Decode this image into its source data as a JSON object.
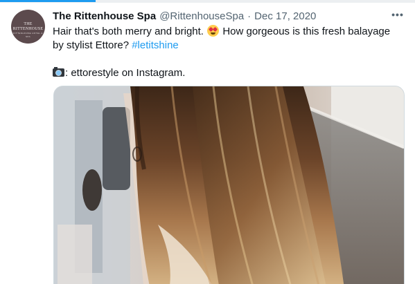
{
  "tweet": {
    "display_name": "The Rittenhouse Spa",
    "handle": "@RittenhouseSpa",
    "separator": "·",
    "date": "Dec 17, 2020",
    "more_label": "•••",
    "text_line1_part1": "Hair that's both merry and bright.",
    "text_line1_part2": "How gorgeous is this fresh balayage",
    "text_line2_part1": "by stylist Ettore?",
    "hashtag": "#letitshine",
    "credit": ": ettorestyle on Instagram.",
    "emoji_1": "smiling-face-with-heart-eyes",
    "emoji_2": "camera-with-flash"
  },
  "avatar": {
    "name": "THE RITTENHOUSE",
    "subtitle": "RITTENHOUSE HOTEL & SPA"
  },
  "media": {
    "description_icon": "photo-thumbnail"
  },
  "colors": {
    "link": "#1d9bf0",
    "text": "#0f1419",
    "secondary": "#536471",
    "border": "#cfd9de",
    "avatar_bg": "#5c4a4d"
  }
}
